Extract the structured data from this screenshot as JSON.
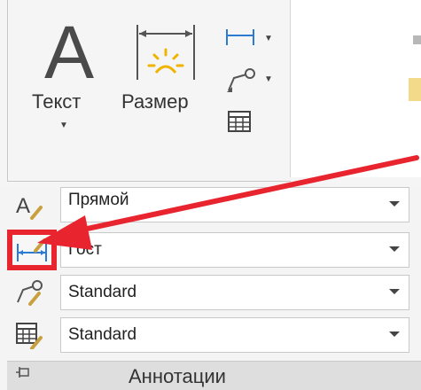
{
  "ribbon": {
    "text_button": {
      "label": "Текст"
    },
    "dimension_button": {
      "label": "Размер"
    },
    "panel_title": "Аннотации"
  },
  "styles": [
    {
      "icon": "text-style-icon",
      "value": "Прямой"
    },
    {
      "icon": "dimension-style-icon",
      "value": "Гост"
    },
    {
      "icon": "multileader-style-icon",
      "value": "Standard"
    },
    {
      "icon": "table-style-icon",
      "value": "Standard"
    }
  ],
  "colors": {
    "highlight": "#e8242f",
    "arrow": "#e8242f"
  }
}
